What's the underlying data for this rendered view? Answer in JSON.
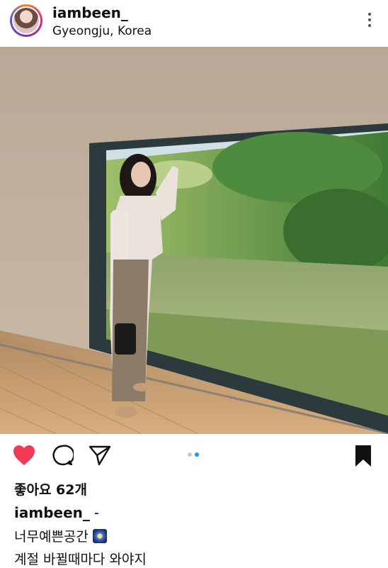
{
  "header": {
    "username": "iambeen_",
    "location": "Gyeongju, Korea",
    "menu_icon": "more-vertical-icon"
  },
  "post": {
    "image_description": "Woman standing by large window overlooking pond and trees",
    "carousel_total": 2,
    "carousel_active": 2
  },
  "actions": {
    "like_icon": "heart-filled-icon",
    "comment_icon": "comment-icon",
    "share_icon": "paper-plane-icon",
    "save_icon": "bookmark-filled-icon"
  },
  "likes_text": "좋아요 62개",
  "caption": {
    "username": "iambeen_",
    "dash": "-",
    "line1": "너무예쁜공간",
    "line1_emoji": "night-sky-emoji",
    "line2": "계절 바뀔때마다 와야지"
  },
  "colors": {
    "like": "#ee3a55",
    "carousel_active": "#2196f3",
    "text": "#111111"
  }
}
